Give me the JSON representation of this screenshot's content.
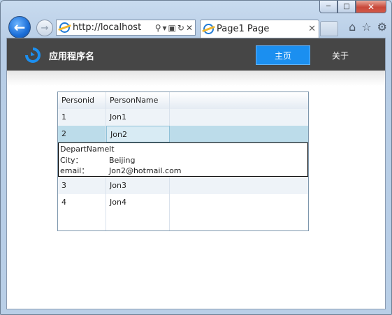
{
  "browser": {
    "address_url": "http://localhost",
    "tab_title": "Page1 Page"
  },
  "app": {
    "title": "应用程序名",
    "nav": {
      "home": "主页",
      "about": "关于"
    }
  },
  "grid": {
    "columns": [
      "Personid",
      "PersonName"
    ],
    "rows": [
      {
        "id": "1",
        "name": "Jon1"
      },
      {
        "id": "2",
        "name": "Jon2"
      },
      {
        "id": "3",
        "name": "Jon3"
      },
      {
        "id": "4",
        "name": "Jon4"
      }
    ],
    "selected_row": "2",
    "details": {
      "depart_label": "DepartName",
      "depart_value": "It",
      "city_label": "City：",
      "city_value": "Beijing",
      "email_label": "email：",
      "email_value": "Jon2@hotmail.com"
    }
  }
}
